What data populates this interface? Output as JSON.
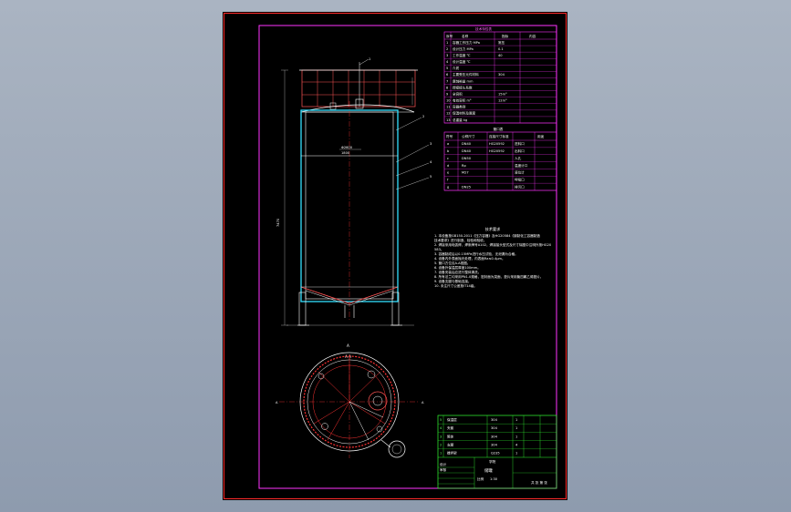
{
  "colors": {
    "background": "#000000",
    "frame_outer": "#ff2a2a",
    "frame_inner": "#ff33ff",
    "shell": "#33e0ff",
    "outline": "#ffffff",
    "hatch": "#ff3333",
    "title_block": "#33ff33",
    "desktop": "#9aa6b8"
  },
  "views": {
    "front_label": "A",
    "top_label": "A-A",
    "side_mark": "A",
    "height_dim": "7470",
    "inner_dims": [
      "Φ2600",
      "1800"
    ],
    "top_frame_label": "1",
    "callouts": [
      "2",
      "3",
      "4",
      "5"
    ]
  },
  "spec_table": {
    "title": "技术特性表",
    "headers": [
      "序号",
      "名称",
      "指标",
      "内容"
    ],
    "rows": [
      [
        "1",
        "容器工作压力 MPa",
        "常压"
      ],
      [
        "2",
        "设计压力 MPa",
        "0.1"
      ],
      [
        "3",
        "工作温度 ℃",
        "40"
      ],
      [
        "4",
        "设计温度 ℃",
        ""
      ],
      [
        "5",
        "介质",
        ""
      ],
      [
        "6",
        "主要受压元件材料",
        "304"
      ],
      [
        "7",
        "腐蚀裕量 mm",
        ""
      ],
      [
        "8",
        "焊接接头系数",
        ""
      ],
      [
        "9",
        "全容积",
        "15m³"
      ],
      [
        "10",
        "有效容积 m³",
        "12m³"
      ],
      [
        "11",
        "容器类别",
        ""
      ],
      [
        "12",
        "保温材料及厚度",
        ""
      ],
      [
        "13",
        "总重量 kg",
        ""
      ]
    ]
  },
  "nozzle_table": {
    "title": "管口表",
    "headers": [
      "符号",
      "公称尺寸",
      "连接尺寸标准",
      "用途"
    ],
    "rows": [
      [
        "a",
        "DN40",
        "HG20592",
        "进料口"
      ],
      [
        "b",
        "DN40",
        "HG20592",
        "出料口"
      ],
      [
        "c",
        "DN50",
        "",
        "人孔"
      ],
      [
        "d",
        "Rp",
        "",
        "温度计口"
      ],
      [
        "e",
        "M27",
        "",
        "液位计"
      ],
      [
        "f",
        "",
        "",
        "呼吸口"
      ],
      [
        "g",
        "DN25",
        "",
        "排污口"
      ]
    ]
  },
  "notes": {
    "title": "技术要求",
    "lines": [
      "1. 本设备按GB150-2011《压力容器》及HG20584《钢制化工容器制造技术要求》进行制造、检验和验收。",
      "2. 焊接采用电弧焊，焊条牌号A102，焊接接头型式及尺寸除图中注明外按HG20583。",
      "3. 容器制成后以0.15MPa进行水压试验，无泄漏为合格。",
      "4. 设备内外表面抛光处理，内表面Ra≤0.4μm。",
      "5. 管口方位见A-A视图。",
      "6. 设备外保温层厚度100mm。",
      "7. 设备安装后应进行整体清洗。",
      "8. 所有法兰均采用PN1.0规格，密封面为突面，垫片采用聚四氟乙烯垫片。",
      "9. 设备支腿与基础连接。",
      "10. 未注尺寸公差按IT14级。"
    ]
  },
  "title_block": {
    "part_rows": [
      [
        "5",
        "保温层",
        "304",
        "1"
      ],
      [
        "4",
        "夹套",
        "304",
        "1"
      ],
      [
        "3",
        "筒体",
        "304",
        "1"
      ],
      [
        "2",
        "支腿",
        "304",
        "4"
      ],
      [
        "1",
        "搅拌架",
        "Q235",
        "1"
      ]
    ],
    "drawing_name": "储罐",
    "scale_label": "比例",
    "scale": "1:30",
    "sheet": "共 张 第 张",
    "designer": "设计",
    "checker": "审核",
    "company": "学院"
  }
}
